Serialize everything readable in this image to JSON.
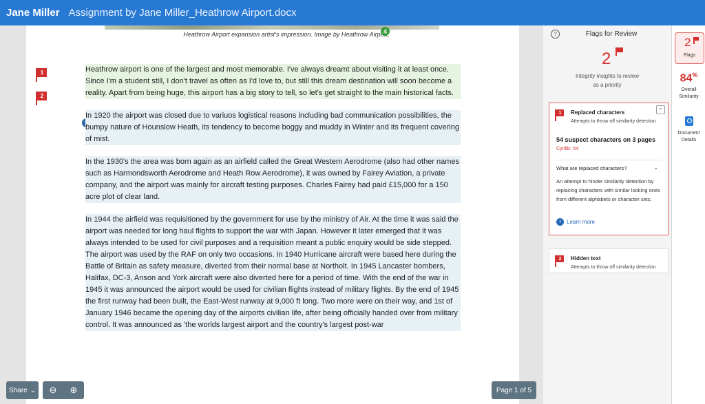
{
  "header": {
    "author": "Jane Miller",
    "doc_title": "Assignment by Jane Miller_Heathrow Airport.docx"
  },
  "document": {
    "caption": "Heathrow Airport expansion artist's impression. Image by Heathrow Airport.",
    "badge_green": "4",
    "badge_blue": "2",
    "flag_markers": [
      "1",
      "2"
    ],
    "paragraphs": [
      "Heathrow airport is one of the largest and most memorable. I've always dreamt about visiting it at least once. Since I'm a student still, I don't travel as often as I'd love to, but still this dream destination will soon become a reality. Apart from being huge, this  airport has a big story to tell, so let's get straight to the main historical facts.",
      "In 1920 the airport was closed due to variuos  logistical reasons including bad communication possibilities, the bumpy nature of Hounslow Heath, its tendency to become boggy and muddy in Winter  and its frequent covering of mist.",
      "In the 1930's the area was born again as an airfield called the Great Western Aerodrome (also had other names such as Harmondsworth Aerodrome and Heath Row Aerodrome), it was owned by Fairey Aviation, a private company, and the airport was mainly for aircraft testing purposes. Charles Fairey had paid £15,000 for a 150 acre plot of clear land.",
      "In 1944   the airfield was requisitioned by the government for use by the ministry of Air. At the time it was said the airport was needed for long haul flights to support the war with Japan. However it later emerged that it was always intended to be used for civil purposes and a requisition meant a public enquiry would be side stepped. The airport was used by the RAF on only two occasions. In 1940 Hurricane aircraft were based here during the Battle of Britain as safety measure, diverted from their normal base at Northolt. In 1945 Lancaster bombers, Halifax, DC-3, Anson and York aircraft were also diverted here for a period of time. With the end of the war in 1945 it was announced the airport would be used for civilian flights instead of military flights. By the end of 1945 the first runway had been built, the East-West runway at  9,000 ft long. Two more were on their way, and 1st of January 1946 became the opening day of the airports civilian life, after being officially handed over from military control. It was announced as 'the worlds largest airport and the country's largest post-war"
    ]
  },
  "controls": {
    "share_label": "Share",
    "share_icon": "chevron-down-icon",
    "zoom_out_icon": "zoom-out-icon",
    "zoom_in_icon": "zoom-in-icon",
    "page_indicator": "Page 1 of 5"
  },
  "flags_panel": {
    "title": "Flags for Review",
    "count": "2",
    "integrity_line1": "Integrity insights to review",
    "integrity_line2": "as a priority",
    "cards": [
      {
        "number": "1",
        "title": "Replaced characters",
        "subtitle": "Attempts to throw off similarity detection",
        "suspect": "54 suspect characters on 3 pages",
        "cyrillic": "Cyrillic: 54",
        "question": "What are replaced characters?",
        "explanation": "An attempt to hinder similarity detection by replacing characters with similar looking ones from different alphabets or character sets.",
        "learn_more": "Learn more"
      },
      {
        "number": "2",
        "title": "Hidden text",
        "subtitle": "Attempts to throw off similarity detection"
      }
    ]
  },
  "right_rail": {
    "flags_count": "2",
    "flags_label": "Flags",
    "similarity_pct": "84",
    "similarity_sup": "%",
    "similarity_label_1": "Overall",
    "similarity_label_2": "Similarity",
    "details_label_1": "Document",
    "details_label_2": "Details"
  },
  "colors": {
    "header_blue": "#2879d4",
    "flag_red": "#d32f2f",
    "control_gray": "#5f7483"
  }
}
